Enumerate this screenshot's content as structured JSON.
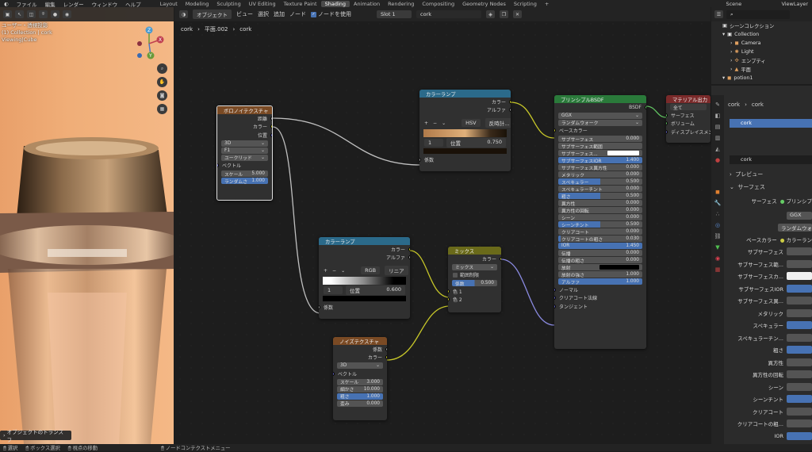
{
  "topbar": {
    "menus": [
      "ファイル",
      "編集",
      "レンダー",
      "ウィンドウ",
      "ヘルプ"
    ],
    "workspaces": [
      "Layout",
      "Modeling",
      "Sculpting",
      "UV Editing",
      "Texture Paint",
      "Shading",
      "Animation",
      "Rendering",
      "Compositing",
      "Geometry Nodes",
      "Scripting"
    ],
    "active": "Shading",
    "plus": "+",
    "scene": "Scene",
    "viewlayer": "ViewLayer"
  },
  "viewport": {
    "lines": [
      "ユーザー・透視投影",
      "(1) Collection | cork",
      "Viewing|Cube"
    ],
    "axis": {
      "x": "X",
      "y": "Y",
      "z": "Z"
    },
    "op": "オブジェクトのトランスフ"
  },
  "editor": {
    "mode": "オブジェクト",
    "menus": [
      "ビュー",
      "選択",
      "追加",
      "ノード"
    ],
    "use_nodes": "ノードを使用",
    "slot": "Slot 1",
    "material": "cork",
    "breadcrumb": [
      "cork",
      "平面.002",
      "cork"
    ]
  },
  "nodes": {
    "voronoi": {
      "title": "ボロノイテクスチャ",
      "outs": [
        "距離",
        "カラー",
        "位置"
      ],
      "dims": "3D",
      "feature": "F1",
      "metric": "ユークリッド",
      "vector": "ベクトル",
      "scale_l": "スケール",
      "scale_v": "5.000",
      "rand_l": "ランダムさ",
      "rand_v": "1.000"
    },
    "ramp1": {
      "title": "カラーランプ",
      "outs": [
        "カラー",
        "アルファ"
      ],
      "mode": "HSV",
      "interp": "反時計...",
      "idx": "1",
      "pos_l": "位置",
      "pos_v": "0.750",
      "fac": "係数",
      "btns": [
        "+",
        "−",
        "⌄"
      ]
    },
    "ramp2": {
      "title": "カラーランプ",
      "outs": [
        "カラー",
        "アルファ"
      ],
      "mode": "RGB",
      "interp": "リニア",
      "idx": "1",
      "pos_l": "位置",
      "pos_v": "0.600",
      "fac": "係数",
      "btns": [
        "+",
        "−",
        "⌄"
      ]
    },
    "mix": {
      "title": "ミックス",
      "out": "カラー",
      "blend": "ミックス",
      "clamp": "範囲制限",
      "fac_l": "係数",
      "fac_v": "0.500",
      "c1": "色 1",
      "c2": "色 2"
    },
    "noise": {
      "title": "ノイズテクスチャ",
      "outs": [
        "係数",
        "カラー"
      ],
      "dims": "3D",
      "vector": "ベクトル",
      "fields": [
        {
          "l": "スケール",
          "v": "3.000"
        },
        {
          "l": "細かさ",
          "v": "10.000"
        },
        {
          "l": "粗さ",
          "v": "1.000"
        },
        {
          "l": "歪み",
          "v": "0.000"
        }
      ]
    },
    "bsdf": {
      "title": "プリンシプルBSDF",
      "out": "BSDF",
      "dist": "GGX",
      "sss": "ランダムウォーク",
      "base": "ベースカラー",
      "fields": [
        {
          "l": "サブサーフェス",
          "v": "0.000"
        },
        {
          "l": "サブサーフェス範囲",
          "v": ""
        },
        {
          "l": "サブサーフェス...",
          "v": ""
        },
        {
          "l": "サブサーフェスIOR",
          "v": "1.400"
        },
        {
          "l": "サブサーフェス異方性",
          "v": "0.000"
        },
        {
          "l": "メタリック",
          "v": "0.000"
        },
        {
          "l": "スペキュラー",
          "v": "0.500"
        },
        {
          "l": "スペキュラーチント",
          "v": "0.000"
        },
        {
          "l": "粗さ",
          "v": "0.500"
        },
        {
          "l": "異方性",
          "v": "0.000"
        },
        {
          "l": "異方性の回転",
          "v": "0.000"
        },
        {
          "l": "シーン",
          "v": "0.000"
        },
        {
          "l": "シーンチント",
          "v": "0.500"
        },
        {
          "l": "クリアコート",
          "v": "0.000"
        },
        {
          "l": "クリアコートの粗さ",
          "v": "0.030"
        },
        {
          "l": "IOR",
          "v": "1.450"
        },
        {
          "l": "伝播",
          "v": "0.000"
        },
        {
          "l": "伝播の粗さ",
          "v": "0.000"
        },
        {
          "l": "放射",
          "v": ""
        },
        {
          "l": "放射の強さ",
          "v": "1.000"
        },
        {
          "l": "アルファ",
          "v": "1.000"
        }
      ],
      "ins": [
        "ノーマル",
        "クリアコート法線",
        "タンジェント"
      ]
    },
    "output": {
      "title": "マテリアル出力",
      "target": "全て",
      "ins": [
        "サーフェス",
        "ボリューム",
        "ディスプレイスメント"
      ]
    }
  },
  "outliner": {
    "title": "シーンコレクション",
    "items": [
      "Collection",
      "Camera",
      "Light",
      "エンプティ",
      "平面",
      "potion1"
    ]
  },
  "props": {
    "obj": "cork",
    "mat": "cork",
    "slot": "cork",
    "mat2": "cork",
    "preview": "プレビュー",
    "surface_hdr": "サーフェス",
    "surface_l": "サーフェス",
    "surface_v": "プリンシプ",
    "dist": "GGX",
    "sss": "ランダムウォ",
    "base_l": "ベースカラー",
    "base_v": "カラーラン",
    "rows": [
      "サブサーフェス",
      "サブサーフェス範...",
      "サブサーフェスカ...",
      "サブサーフェスIOR",
      "サブサーフェス異...",
      "メタリック",
      "スペキュラー",
      "スペキュラーチン...",
      "粗さ",
      "異方性",
      "異方性の回転",
      "シーン",
      "シーンチント",
      "クリアコート",
      "クリアコートの粗...",
      "IOR"
    ]
  },
  "status": {
    "items": [
      "選択",
      "ボックス選択",
      "視点の移動",
      "ノードコンテクストメニュー"
    ]
  }
}
